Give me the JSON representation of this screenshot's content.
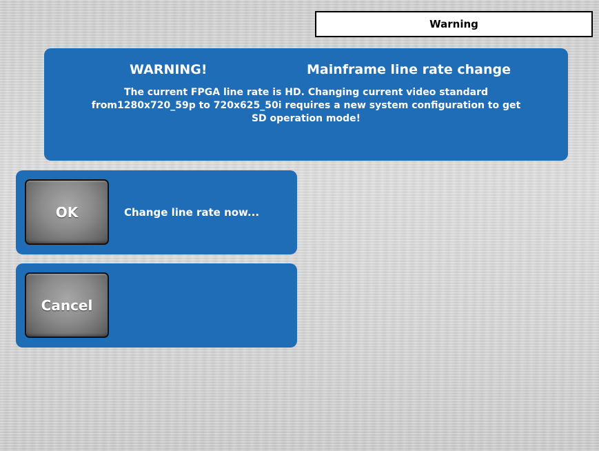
{
  "header": {
    "title": "Warning"
  },
  "warning": {
    "label": "WARNING!",
    "heading": "Mainframe line rate change",
    "message_lines": [
      "The current FPGA line rate is HD. Changing current video standard",
      "from1280x720_59p to 720x625_50i requires a new system configuration to get",
      "SD operation mode!"
    ]
  },
  "actions": {
    "ok": {
      "button_label": "OK",
      "caption": "Change line rate now..."
    },
    "cancel": {
      "button_label": "Cancel"
    }
  },
  "colors": {
    "panel_blue": "#1f6db6",
    "button_gray": "#8b8b8b",
    "text_white": "#ffffff",
    "title_box_bg": "#ffffff"
  }
}
